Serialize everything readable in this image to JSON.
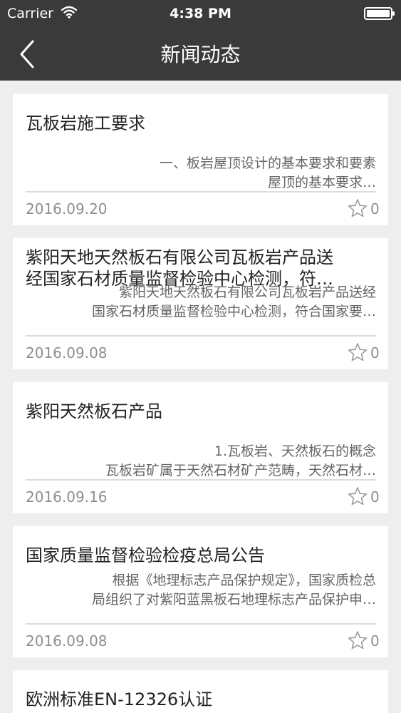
{
  "status_bar": {
    "carrier": "Carrier",
    "time": "4:38 PM"
  },
  "nav": {
    "title": "新闻动态",
    "back_icon": "chevron-left-icon"
  },
  "news": [
    {
      "title": "瓦板岩施工要求",
      "summary_lines": [
        "一、板岩屋顶设计的基本要求和要素",
        "屋顶的基本要求…"
      ],
      "date": "2016.09.20",
      "favorites": "0"
    },
    {
      "title_lines": [
        "紫阳天地天然板石有限公司瓦板岩产品送",
        "经国家石材质量监督检验中心检测，符…"
      ],
      "summary_lines": [
        "紫阳天地天然板石有限公司瓦板岩产品送经",
        "国家石材质量监督检验中心检测，符合国家要…"
      ],
      "date": "2016.09.08",
      "favorites": "0"
    },
    {
      "title": "紫阳天然板石产品",
      "summary_lines": [
        "1.瓦板岩、天然板石的概念",
        "瓦板岩矿属于天然石材矿产范畴，天然石材…"
      ],
      "date": "2016.09.16",
      "favorites": "0"
    },
    {
      "title": "国家质量监督检验检疫总局公告",
      "summary_lines": [
        "根据《地理标志产品保护规定》，国家质检总",
        "局组织了对紫阳蓝黑板石地理标志产品保护申…"
      ],
      "date": "2016.09.08",
      "favorites": "0"
    },
    {
      "title": "欧洲标准EN-12326认证"
    }
  ]
}
